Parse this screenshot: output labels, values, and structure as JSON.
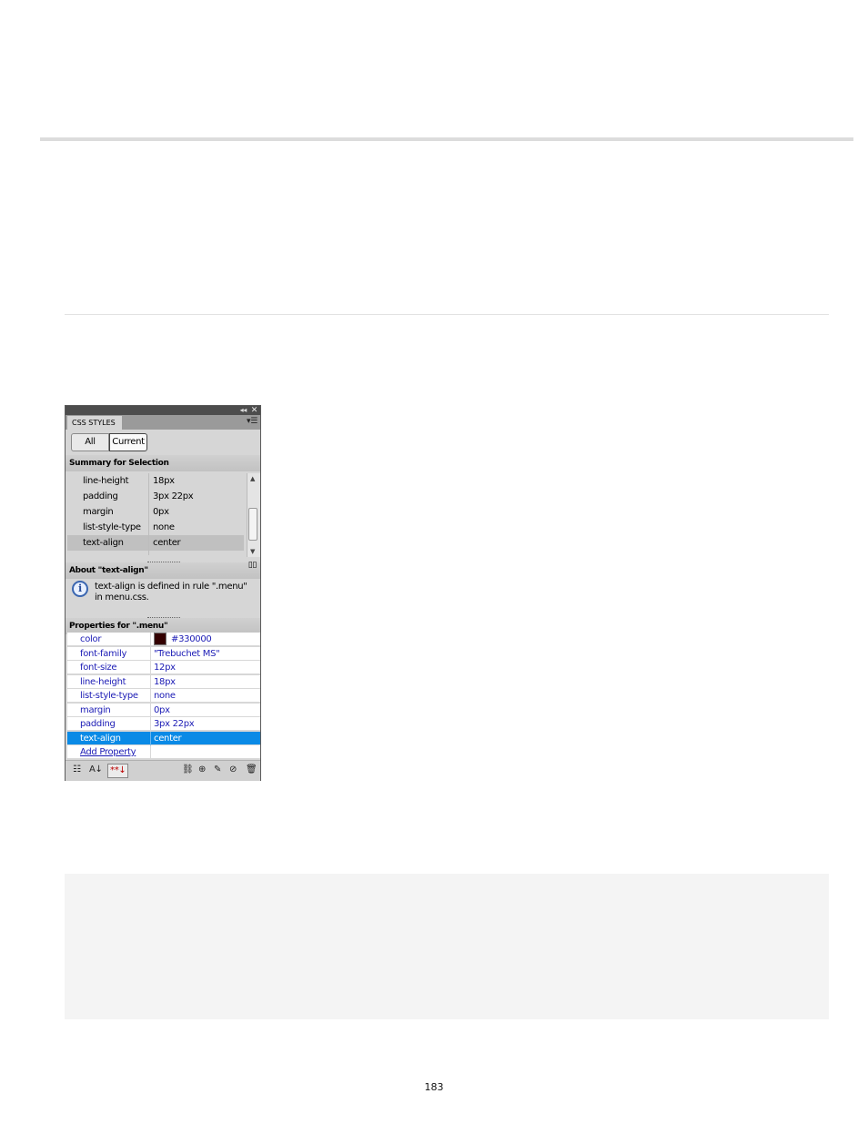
{
  "page": {
    "page_number": "183"
  },
  "css_panel": {
    "tab_label": "CSS STYLES",
    "buttons": {
      "all": "All",
      "current": "Current"
    },
    "summary": {
      "heading": "Summary for Selection",
      "rows": [
        {
          "property": "line-height",
          "value": "18px"
        },
        {
          "property": "padding",
          "value": "3px 22px"
        },
        {
          "property": "margin",
          "value": "0px"
        },
        {
          "property": "list-style-type",
          "value": "none"
        },
        {
          "property": "text-align",
          "value": "center",
          "selected": true
        }
      ]
    },
    "about": {
      "heading": "About \"text-align\"",
      "text": "text-align is defined in rule \".menu\" in menu.css."
    },
    "properties": {
      "heading": "Properties for \".menu\"",
      "rows": [
        {
          "property": "color",
          "value": "#330000",
          "swatch": "#330000"
        },
        {
          "property": "font-family",
          "value": "\"Trebuchet MS\""
        },
        {
          "property": "font-size",
          "value": "12px"
        },
        {
          "property": "line-height",
          "value": "18px"
        },
        {
          "property": "list-style-type",
          "value": "none"
        },
        {
          "property": "margin",
          "value": "0px"
        },
        {
          "property": "padding",
          "value": "3px 22px"
        },
        {
          "property": "text-align",
          "value": "center",
          "selected": true
        }
      ],
      "add_property": "Add Property"
    },
    "toolbar_icons": [
      "category-view-icon",
      "alpha-view-icon",
      "set-properties-icon",
      "attach-stylesheet-icon",
      "new-rule-icon",
      "edit-rule-icon",
      "disable-property-icon",
      "delete-rule-icon"
    ]
  },
  "colors": {
    "selection": "#0a8ae6",
    "property_text": "#1b1bb5"
  }
}
